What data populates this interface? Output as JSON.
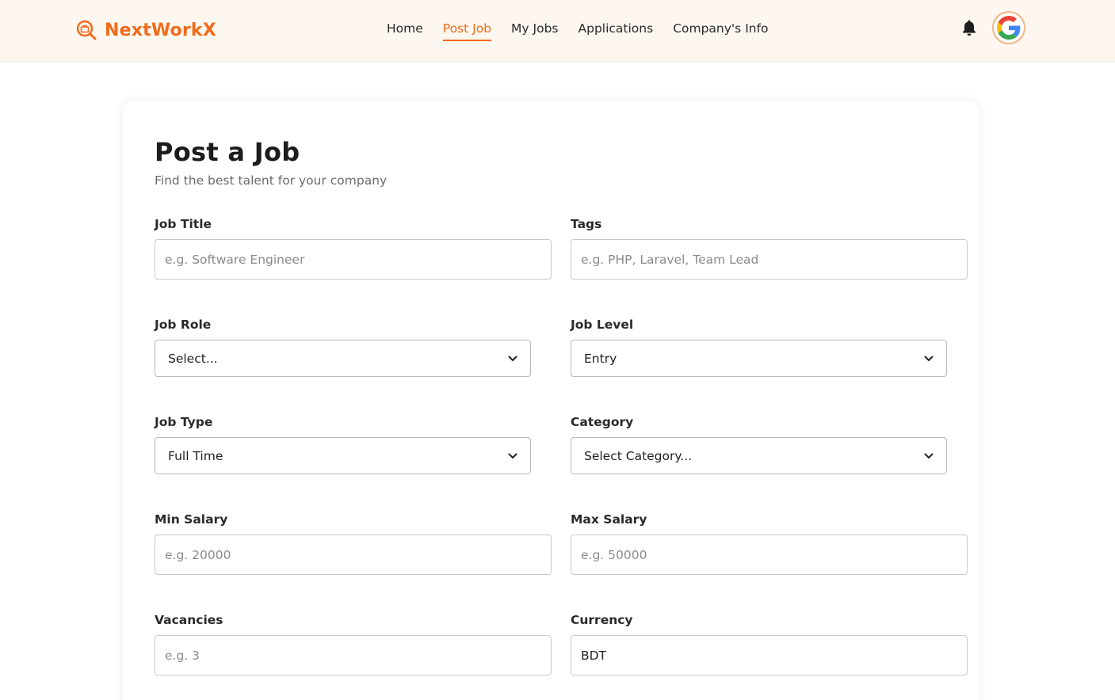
{
  "brand": {
    "name": "NextWorkX",
    "accent": "#f26a1b"
  },
  "nav": {
    "items": [
      {
        "label": "Home",
        "active": false
      },
      {
        "label": "Post Job",
        "active": true
      },
      {
        "label": "My Jobs",
        "active": false
      },
      {
        "label": "Applications",
        "active": false
      },
      {
        "label": "Company's Info",
        "active": false
      }
    ]
  },
  "header_icons": {
    "notifications": "bell-icon",
    "account": "google-avatar-icon"
  },
  "form": {
    "title": "Post a Job",
    "subtitle": "Find the best talent for your company",
    "job_title": {
      "label": "Job Title",
      "placeholder": "e.g. Software Engineer",
      "value": ""
    },
    "tags": {
      "label": "Tags",
      "placeholder": "e.g. PHP, Laravel, Team Lead",
      "value": ""
    },
    "job_role": {
      "label": "Job Role",
      "selected": "Select..."
    },
    "job_level": {
      "label": "Job Level",
      "selected": "Entry"
    },
    "job_type": {
      "label": "Job Type",
      "selected": "Full Time"
    },
    "category": {
      "label": "Category",
      "selected": "Select Category..."
    },
    "min_salary": {
      "label": "Min Salary",
      "placeholder": "e.g. 20000",
      "value": ""
    },
    "max_salary": {
      "label": "Max Salary",
      "placeholder": "e.g. 50000",
      "value": ""
    },
    "vacancies": {
      "label": "Vacancies",
      "placeholder": "e.g. 3",
      "value": ""
    },
    "currency": {
      "label": "Currency",
      "value": "BDT"
    }
  }
}
